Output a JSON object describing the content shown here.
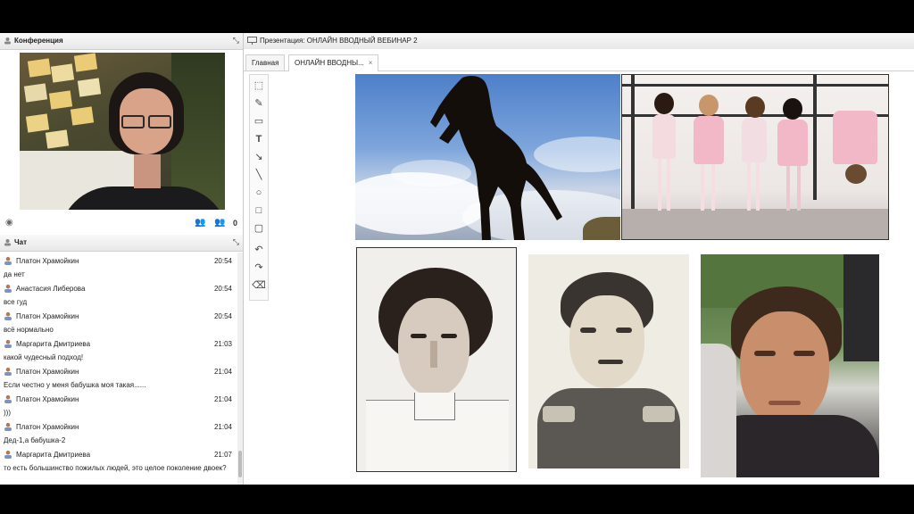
{
  "conference": {
    "title": "Конференция",
    "participants_count": "0"
  },
  "chat": {
    "title": "Чат",
    "messages": [
      {
        "name": "Платон Храмойкин",
        "time": "20:54",
        "text": "да нет"
      },
      {
        "name": "Анастасия Либерова",
        "time": "20:54",
        "text": "все гуд"
      },
      {
        "name": "Платон Храмойкин",
        "time": "20:54",
        "text": "всё нормально"
      },
      {
        "name": "Маргарита Дмитриева",
        "time": "21:03",
        "text": "какой чудесный подход!"
      },
      {
        "name": "Платон Храмойкин",
        "time": "21:04",
        "text": "Если честно у меня бабушка моя такая......"
      },
      {
        "name": "Платон Храмойкин",
        "time": "21:04",
        "text": ")))"
      },
      {
        "name": "Платон Храмойкин",
        "time": "21:04",
        "text": "Дед-1,а бабушка-2"
      },
      {
        "name": "Маргарита Дмитриева",
        "time": "21:07",
        "text": "то есть большинство пожилых людей, это целое поколение двоек?"
      }
    ]
  },
  "presentation": {
    "header": "Презентация: ОНЛАЙН ВВОДНЫЙ ВЕБИНАР 2",
    "tabs": [
      {
        "label": "Главная"
      },
      {
        "label": "ОНЛАЙН ВВОДНЫ..."
      }
    ],
    "tools": [
      "pointer-icon",
      "pencil-icon",
      "eraser-icon",
      "text-icon",
      "arrow-icon",
      "line-icon",
      "circle-icon",
      "rectangle-icon",
      "rounded-rectangle-icon",
      "undo-icon",
      "redo-icon",
      "clear-icon"
    ]
  },
  "colors": {
    "panel_header": "#ececec",
    "border": "#c9c9c9",
    "letterbox": "#000000"
  }
}
